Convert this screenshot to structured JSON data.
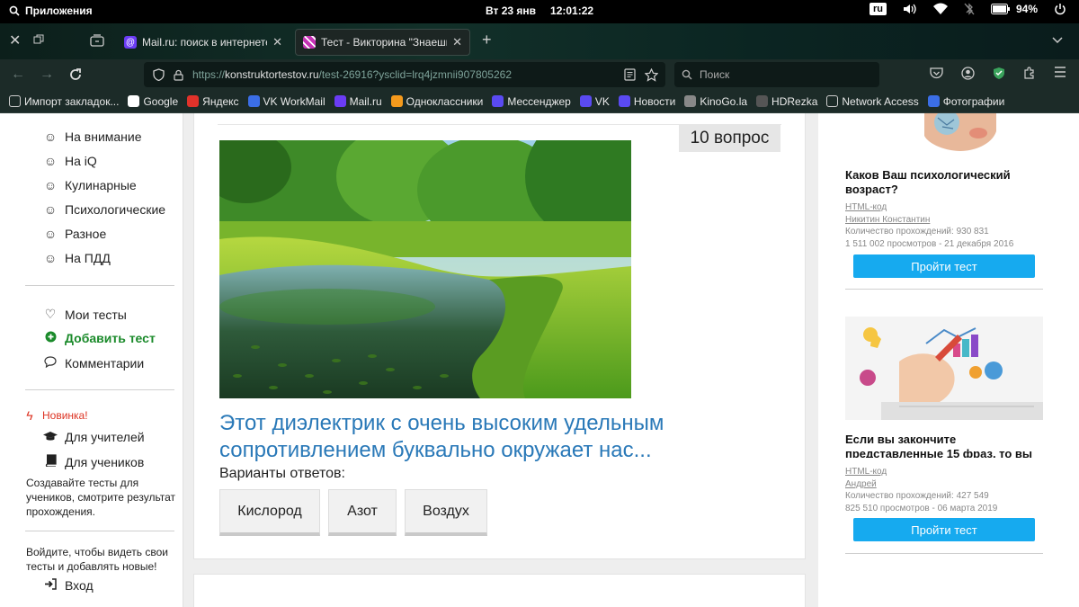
{
  "system": {
    "apps_label": "Приложения",
    "date": "Вт 23 янв",
    "time": "12:01:22",
    "lang": "ru",
    "battery": "94%"
  },
  "tabs": [
    {
      "title": "Mail.ru: поиск в интернете",
      "fav_color": "#6b3cf5"
    },
    {
      "title": "Тест - Викторина \"Знаешь ли",
      "fav_color": "#c532b5"
    }
  ],
  "urlbar": {
    "prefix": "https://",
    "domain": "konstruktortestov.ru",
    "path": "/test-26916?ysclid=lrq4jzmnii907805262"
  },
  "search": {
    "placeholder": "Поиск"
  },
  "bookmarks": [
    {
      "label": "Импорт закладок...",
      "color": "#1c2b28",
      "icon": "import-icon"
    },
    {
      "label": "Google",
      "color": "#ffffff",
      "icon": "google-icon"
    },
    {
      "label": "Яндекс",
      "color": "#e1322a",
      "icon": "yandex-icon"
    },
    {
      "label": "VK WorkMail",
      "color": "#3b6ee6",
      "icon": "vk-workmail-icon"
    },
    {
      "label": "Mail.ru",
      "color": "#6b3cf5",
      "icon": "mailru-icon"
    },
    {
      "label": "Одноклассники",
      "color": "#f59a1c",
      "icon": "ok-icon"
    },
    {
      "label": "Мессенджер",
      "color": "#5a4af2",
      "icon": "messenger-icon"
    },
    {
      "label": "VK",
      "color": "#5a4af2",
      "icon": "vk-icon"
    },
    {
      "label": "Новости",
      "color": "#5a4af2",
      "icon": "news-icon"
    },
    {
      "label": "KinoGo.la",
      "color": "#888888",
      "icon": "kinogo-icon"
    },
    {
      "label": "HDRezka",
      "color": "#555555",
      "icon": "hdrezka-icon"
    },
    {
      "label": "Network Access",
      "color": "#1c2b28",
      "icon": "globe-icon"
    },
    {
      "label": "Фотографии",
      "color": "#3b6ee6",
      "icon": "photos-icon"
    }
  ],
  "left_sidebar": {
    "categories": [
      "На внимание",
      "На iQ",
      "Кулинарные",
      "Психологические",
      "Разное",
      "На ПДД"
    ],
    "my_tests": "Мои тесты",
    "add_test": "Добавить тест",
    "comments": "Комментарии",
    "new_label": "Новинка!",
    "for_teachers": "Для учителей",
    "for_students": "Для учеников",
    "create_text": "Создавайте тесты для учеников, смотрите результат прохождения.",
    "login_text": "Войдите, чтобы видеть свои тесты и добавлять новые!",
    "login": "Вход"
  },
  "question": {
    "badge": "10 вопрос",
    "text": "Этот диэлектрик с очень высоким удельным сопротивлением буквально окружает нас...",
    "variants_label": "Варианты ответов:",
    "answers": [
      "Кислород",
      "Азот",
      "Воздух"
    ]
  },
  "right_sidebar": {
    "cards": [
      {
        "title": "Каков Ваш психологический возраст?",
        "html_code": "HTML-код",
        "author": "Никитин Константин",
        "passes": "Количество прохождений: 930 831",
        "views": "1 511 002 просмотров - 21 декабря 2016",
        "button": "Пройти тест"
      },
      {
        "title": "Если вы закончите представленные 15 фраз, то вы",
        "html_code": "HTML-код",
        "author": "Андрей",
        "passes": "Количество прохождений: 427 549",
        "views": "825 510 просмотров - 06 марта 2019",
        "button": "Пройти тест"
      }
    ]
  }
}
